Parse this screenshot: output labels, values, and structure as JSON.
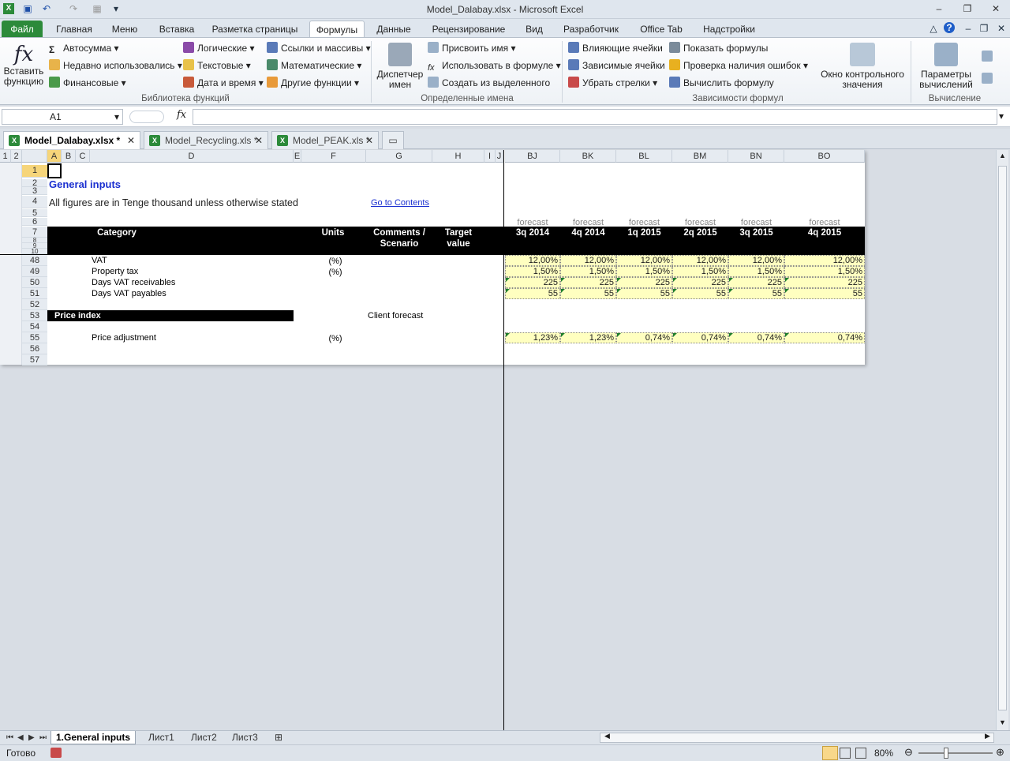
{
  "window": {
    "title": "Model_Dalabay.xlsx - Microsoft Excel"
  },
  "ribbon_tabs": [
    "Файл",
    "Главная",
    "Меню",
    "Вставка",
    "Разметка страницы",
    "Формулы",
    "Данные",
    "Рецензирование",
    "Вид",
    "Разработчик",
    "Office Tab",
    "Надстройки"
  ],
  "ribbon": {
    "insert_function": "Вставить функцию",
    "autosum": "Автосумма",
    "recent": "Недавно использовались",
    "financial": "Финансовые",
    "logical": "Логические",
    "text": "Текстовые",
    "datetime": "Дата и время",
    "lookup": "Ссылки и массивы",
    "math": "Математические",
    "other": "Другие функции",
    "group_library": "Библиотека функций",
    "name_manager": "Диспетчер имен",
    "define_name": "Присвоить имя",
    "use_in_formula": "Использовать в формуле",
    "create_from_selection": "Создать из выделенного",
    "group_names": "Определенные имена",
    "trace_precedents": "Влияющие ячейки",
    "trace_dependents": "Зависимые ячейки",
    "remove_arrows": "Убрать стрелки",
    "show_formulas": "Показать формулы",
    "error_checking": "Проверка наличия ошибок",
    "evaluate_formula": "Вычислить формулу",
    "group_auditing": "Зависимости формул",
    "watch_window": "Окно контрольного значения",
    "calc_options": "Параметры вычислений",
    "group_calc": "Вычисление"
  },
  "formula_bar": {
    "name_box": "A1",
    "fx": "fx",
    "formula": ""
  },
  "doc_tabs": [
    {
      "label": "Model_Dalabay.xlsx *",
      "active": true
    },
    {
      "label": "Model_Recycling.xls *",
      "active": false
    },
    {
      "label": "Model_PEAK.xls *",
      "active": false
    }
  ],
  "columns_left": [
    "A",
    "B",
    "C",
    "D",
    "E",
    "F",
    "G",
    "H",
    "I",
    "J"
  ],
  "columns_right": [
    "BJ",
    "BK",
    "BL",
    "BM",
    "BN",
    "BO"
  ],
  "outline_levels": [
    "1",
    "2"
  ],
  "rows": [
    "1",
    "2",
    "3",
    "4",
    "5",
    "6",
    "7",
    "8",
    "9",
    "10",
    "48",
    "49",
    "50",
    "51",
    "52",
    "53",
    "54",
    "55",
    "56",
    "57"
  ],
  "sheet": {
    "title": "General inputs",
    "subtitle": "All figures are in Tenge thousand unless otherwise stated",
    "link": "Go to Contents",
    "hdr_category": "Category",
    "hdr_units": "Units",
    "hdr_comments": "Comments / Scenario",
    "hdr_target": "Target value",
    "forecast_label": "forecast",
    "periods": [
      "3q 2014",
      "4q 2014",
      "1q 2015",
      "2q 2015",
      "3q 2015",
      "4q 2015"
    ],
    "rows": [
      {
        "label": "VAT",
        "units": "(%)",
        "values": [
          "12,00%",
          "12,00%",
          "12,00%",
          "12,00%",
          "12,00%",
          "12,00%"
        ]
      },
      {
        "label": "Property tax",
        "units": "(%)",
        "values": [
          "1,50%",
          "1,50%",
          "1,50%",
          "1,50%",
          "1,50%",
          "1,50%"
        ]
      },
      {
        "label": "Days VAT receivables",
        "units": "",
        "values": [
          "225",
          "225",
          "225",
          "225",
          "225",
          "225"
        ]
      },
      {
        "label": "Days VAT payables",
        "units": "",
        "values": [
          "55",
          "55",
          "55",
          "55",
          "55",
          "55"
        ]
      }
    ],
    "price_index": "Price index",
    "client_forecast": "Client forecast",
    "price_adj": {
      "label": "Price adjustment",
      "units": "(%)",
      "values": [
        "1,23%",
        "1,23%",
        "0,74%",
        "0,74%",
        "0,74%",
        "0,74%"
      ]
    }
  },
  "sheet_tabs": [
    "1.General inputs",
    "Лист1",
    "Лист2",
    "Лист3"
  ],
  "status": {
    "ready": "Готово",
    "zoom": "80%"
  }
}
